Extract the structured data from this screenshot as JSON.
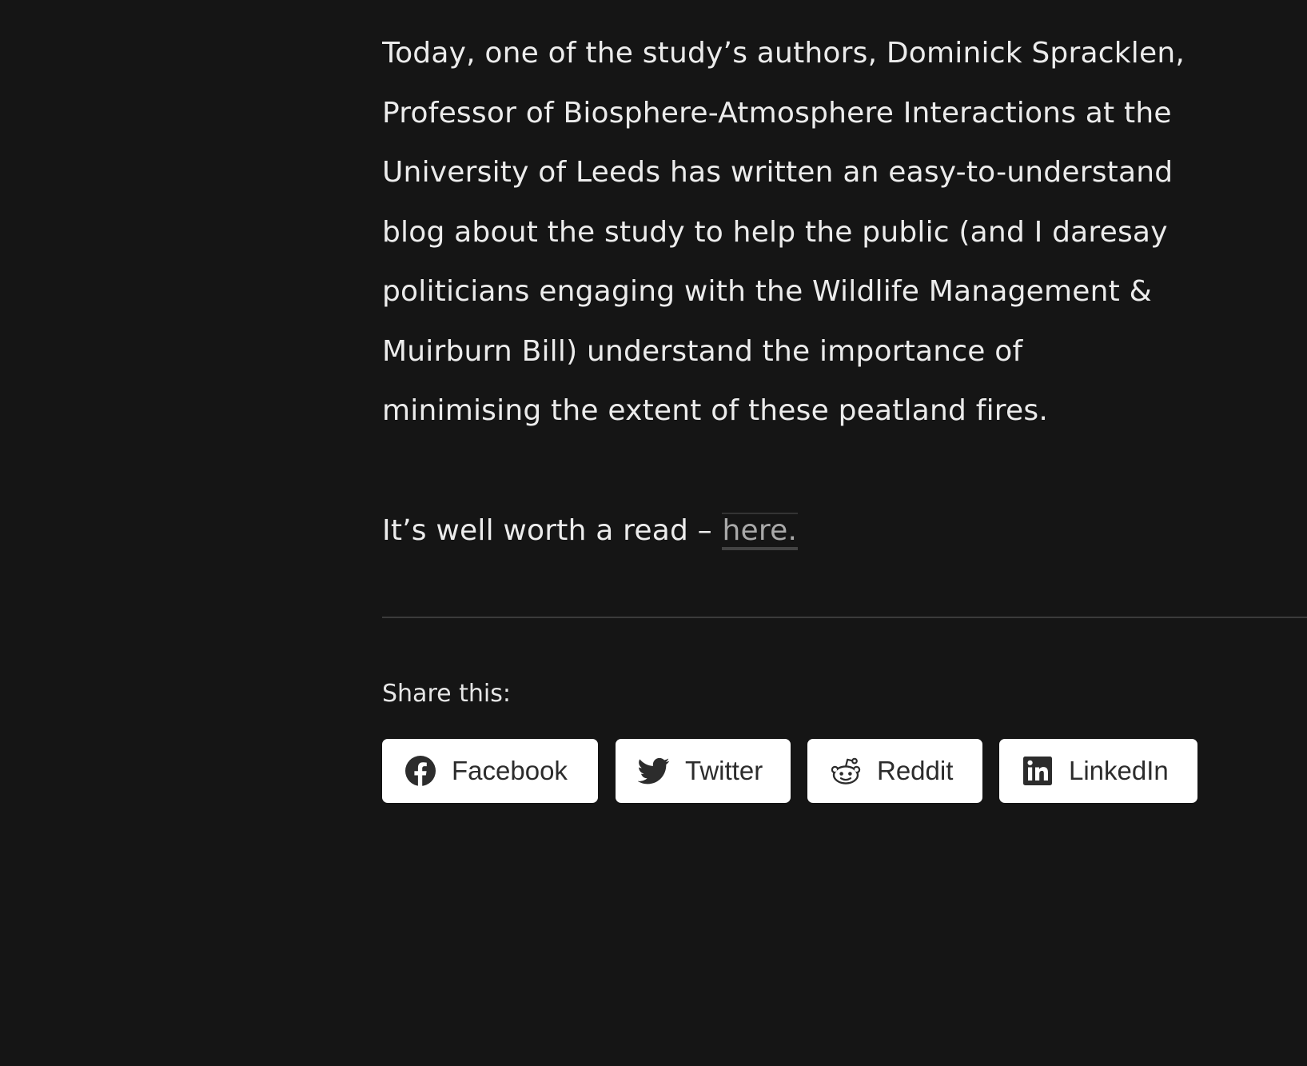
{
  "article": {
    "paragraph1_lines": [
      "Today, one of the study’s authors, Dominick Spracklen,",
      "Professor of Biosphere-Atmosphere Interactions at the",
      "University of Leeds has written an easy-to-understand",
      "blog about the study to help the public (and I daresay",
      "politicians engaging with the Wildlife Management &",
      "Muirburn Bill) understand the importance of",
      "minimising the extent of these peatland fires."
    ],
    "paragraph2_prefix": "It’s well worth a read – ",
    "paragraph2_link": "here."
  },
  "share": {
    "heading": "Share this:",
    "buttons": [
      {
        "label": "Facebook",
        "icon": "facebook-icon"
      },
      {
        "label": "Twitter",
        "icon": "twitter-icon"
      },
      {
        "label": "Reddit",
        "icon": "reddit-icon"
      },
      {
        "label": "LinkedIn",
        "icon": "linkedin-icon"
      }
    ]
  },
  "colors": {
    "background": "#151515",
    "text": "#ececec",
    "link": "#a9a9a9",
    "button_bg": "#ffffff",
    "button_text": "#2c2c2c"
  }
}
